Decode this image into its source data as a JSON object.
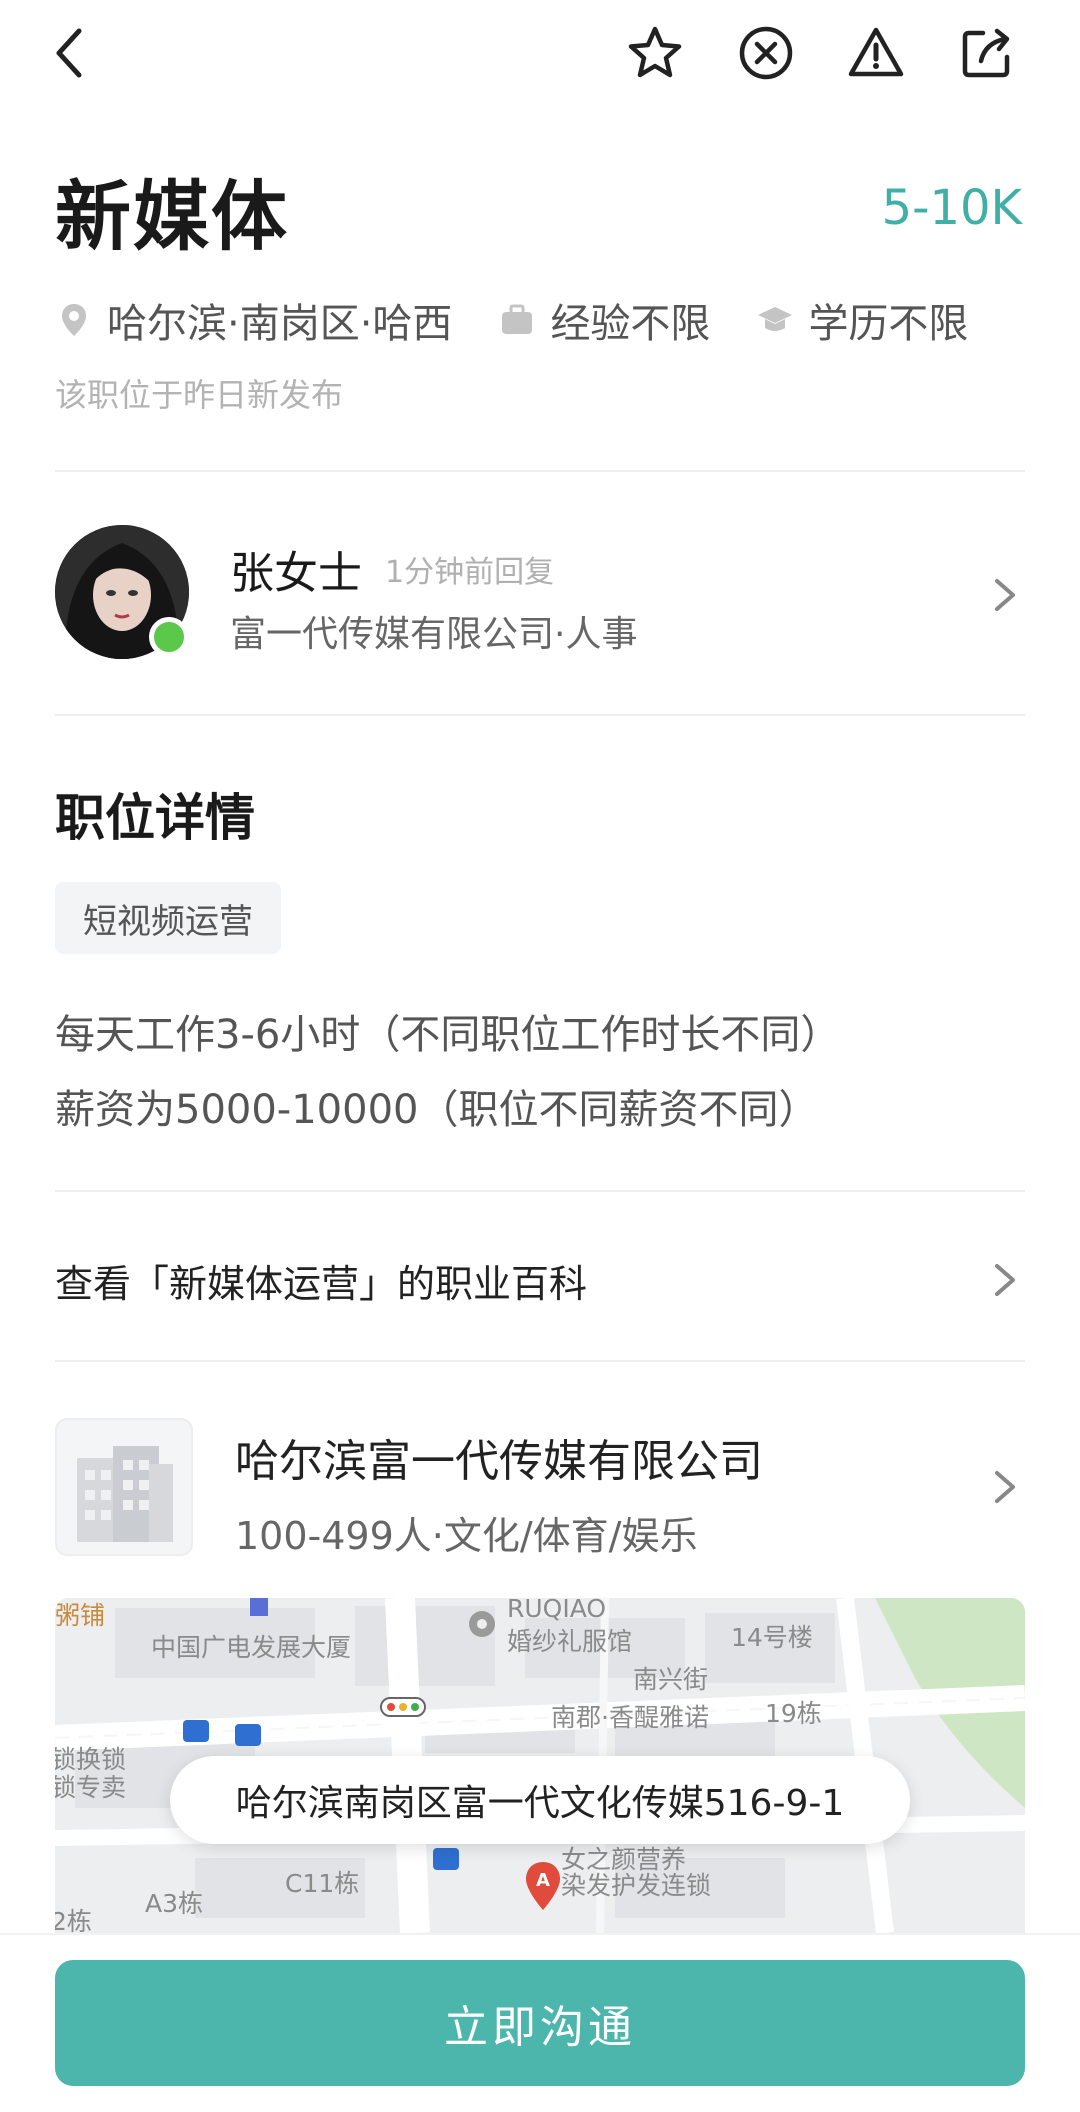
{
  "toolbar": {
    "back_icon": "chevron-left-icon",
    "favorite_icon": "star-icon",
    "not_interested_icon": "close-circle-icon",
    "report_icon": "warning-icon",
    "share_icon": "share-icon"
  },
  "job": {
    "title": "新媒体",
    "salary": "5-10K",
    "location": "哈尔滨·南岗区·哈西",
    "experience": "经验不限",
    "education": "学历不限",
    "posted": "该职位于昨日新发布",
    "accent_color": "#3fb0a6"
  },
  "recruiter": {
    "name": "张女士",
    "reply_time": "1分钟前回复",
    "company_role": "富一代传媒有限公司·人事",
    "online_color": "#5cc84a"
  },
  "details": {
    "section_title": "职位详情",
    "tag": "短视频运营",
    "lines": [
      "每天工作3-6小时（不同职位工作时长不同）",
      "薪资为5000-10000（职位不同薪资不同）"
    ]
  },
  "wiki": {
    "label": "查看「新媒体运营」的职业百科"
  },
  "company": {
    "name": "哈尔滨富一代传媒有限公司",
    "info": "100-499人·文化/体育/娱乐"
  },
  "map": {
    "address": "哈尔滨南岗区富一代文化传媒516-9-1",
    "labels": [
      "粥铺",
      "中国广电发展大厦",
      "RUQIAO",
      "婚纱礼服馆",
      "14号楼",
      "南兴街",
      "南郡·香醍雅诺",
      "19栋",
      "锁换锁",
      "锁专卖",
      "C11栋",
      "A3栋",
      "2栋",
      "女之颜营养",
      "染发护发连锁"
    ],
    "pin_letter": "A"
  },
  "cta": {
    "label": "立即沟通",
    "color": "#4db6ac"
  }
}
